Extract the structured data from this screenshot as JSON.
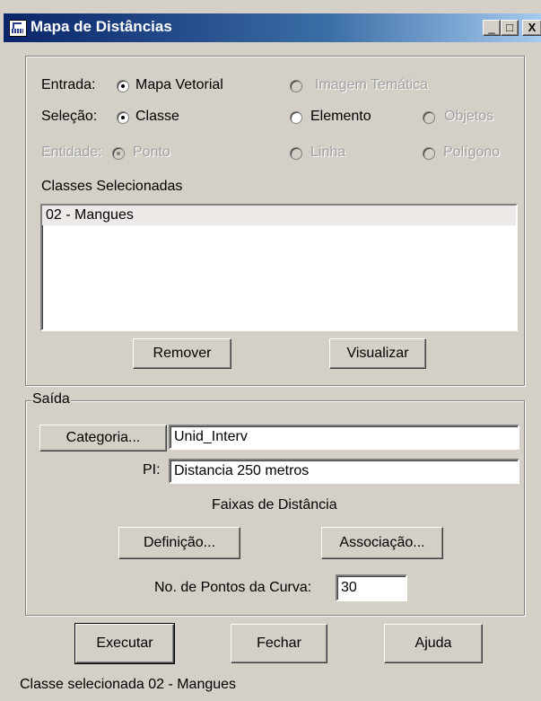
{
  "window": {
    "title": "Mapa de Distâncias",
    "controls": {
      "minimize": "_",
      "maximize": "□",
      "close": "X"
    }
  },
  "entrada": {
    "label": "Entrada:",
    "options": [
      {
        "label": "Mapa Vetorial",
        "checked": true,
        "enabled": true
      },
      {
        "label": "Imagem Temática",
        "checked": false,
        "enabled": false
      }
    ]
  },
  "selecao": {
    "label": "Seleção:",
    "options": [
      {
        "label": "Classe",
        "checked": true,
        "enabled": true
      },
      {
        "label": "Elemento",
        "checked": false,
        "enabled": true
      },
      {
        "label": "Objetos",
        "checked": false,
        "enabled": false
      }
    ]
  },
  "entidade": {
    "label": "Entidade:",
    "options": [
      {
        "label": "Ponto",
        "checked": true,
        "enabled": false
      },
      {
        "label": "Linha",
        "checked": false,
        "enabled": false
      },
      {
        "label": "Polígono",
        "checked": false,
        "enabled": false
      }
    ]
  },
  "classes": {
    "label": "Classes Selecionadas",
    "items": [
      "02 - Mangues"
    ],
    "remove_label": "Remover",
    "view_label": "Visualizar"
  },
  "saida": {
    "legend": "Saída",
    "categoria_label": "Categoria...",
    "categoria_value": "Unid_Interv",
    "pi_label": "PI:",
    "pi_value": "Distancia 250 metros",
    "faixas_label": "Faixas de Distância",
    "definicao_label": "Definição...",
    "associacao_label": "Associação...",
    "pontos_label": "No. de Pontos da Curva:",
    "pontos_value": "30"
  },
  "actions": {
    "execute_label": "Executar",
    "close_label": "Fechar",
    "help_label": "Ajuda"
  },
  "status": {
    "text": "Classe selecionada 02 - Mangues"
  }
}
